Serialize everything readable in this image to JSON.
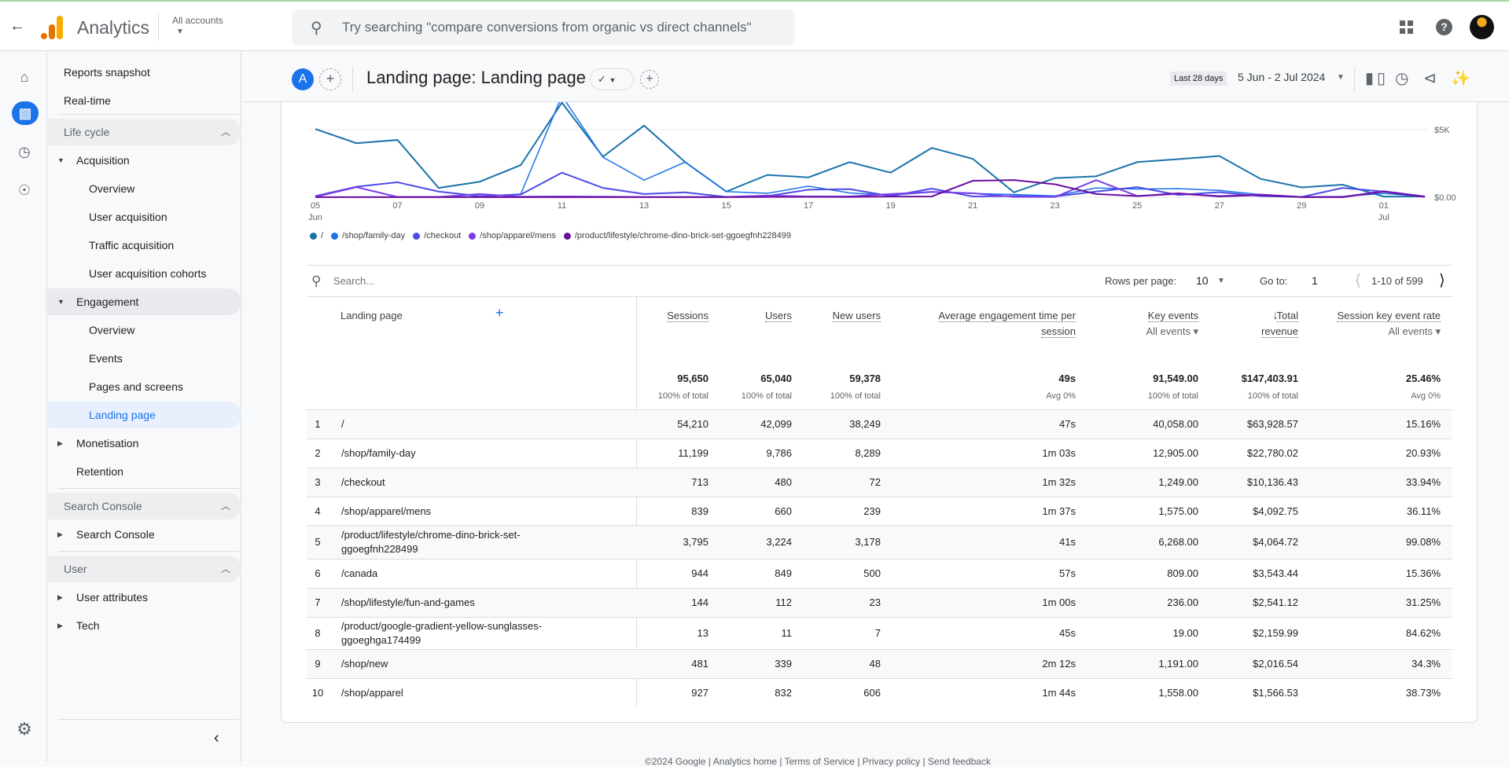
{
  "header": {
    "app_name": "Analytics",
    "accounts_label": "All accounts",
    "search_placeholder": "Try searching \"compare conversions from organic vs direct channels\""
  },
  "rail": {
    "items": [
      "home-icon",
      "reports-icon",
      "explore-icon",
      "advertising-icon"
    ],
    "settings": "gear-icon"
  },
  "nav": {
    "top": [
      {
        "label": "Reports snapshot"
      },
      {
        "label": "Real-time"
      }
    ],
    "sections": [
      {
        "label": "Life cycle",
        "items": [
          {
            "label": "Acquisition",
            "level": 1,
            "caret": "down"
          },
          {
            "label": "Overview",
            "level": 2
          },
          {
            "label": "User acquisition",
            "level": 2
          },
          {
            "label": "Traffic acquisition",
            "level": 2
          },
          {
            "label": "User acquisition cohorts",
            "level": 2
          },
          {
            "label": "Engagement",
            "level": 1,
            "caret": "down",
            "highlight": true
          },
          {
            "label": "Overview",
            "level": 2
          },
          {
            "label": "Events",
            "level": 2
          },
          {
            "label": "Pages and screens",
            "level": 2
          },
          {
            "label": "Landing page",
            "level": 2,
            "active": true
          },
          {
            "label": "Monetisation",
            "level": 1,
            "caret": "right"
          },
          {
            "label": "Retention",
            "level": 1
          }
        ]
      },
      {
        "label": "Search Console",
        "items": [
          {
            "label": "Search Console",
            "level": 1,
            "caret": "right"
          }
        ]
      },
      {
        "label": "User",
        "items": [
          {
            "label": "User attributes",
            "level": 1,
            "caret": "right"
          },
          {
            "label": "Tech",
            "level": 1,
            "caret": "right"
          }
        ]
      }
    ]
  },
  "subheader": {
    "comparison_avatar": "A",
    "title": "Landing page: Landing page",
    "date_preset": "Last 28 days",
    "date_range": "5 Jun - 2 Jul 2024"
  },
  "chart_data": {
    "type": "line",
    "x": [
      "05 Jun",
      "06",
      "07",
      "08",
      "09",
      "10",
      "11",
      "12",
      "13",
      "14",
      "15",
      "16",
      "17",
      "18",
      "19",
      "20",
      "21",
      "22",
      "23",
      "24",
      "25",
      "26",
      "27",
      "28",
      "29",
      "30",
      "01 Jul",
      "02"
    ],
    "x_tick_labels": [
      {
        "day": "05",
        "month": "Jun"
      },
      {
        "day": "07"
      },
      {
        "day": "09"
      },
      {
        "day": "11"
      },
      {
        "day": "13"
      },
      {
        "day": "15"
      },
      {
        "day": "17"
      },
      {
        "day": "19"
      },
      {
        "day": "21"
      },
      {
        "day": "23"
      },
      {
        "day": "25"
      },
      {
        "day": "27"
      },
      {
        "day": "29"
      },
      {
        "day": "01",
        "month": "Jul"
      }
    ],
    "y_tick_labels": [
      "$0.00",
      "$5K"
    ],
    "y_ticks": [
      0,
      5000
    ],
    "ylim": [
      0,
      5600
    ],
    "grid": true,
    "legend_position": "bottom-left",
    "series": [
      {
        "name": "/",
        "color": "#1a73aa",
        "values": [
          5050,
          4000,
          4240,
          690,
          1150,
          2380,
          7000,
          3000,
          5300,
          2600,
          420,
          1650,
          1470,
          2600,
          1820,
          3650,
          2840,
          360,
          1420,
          1550,
          2600,
          2820,
          3050,
          1360,
          730,
          930,
          50,
          60
        ]
      },
      {
        "name": "/shop/family-day",
        "color": "#1a73e8",
        "values": [
          20,
          20,
          30,
          20,
          40,
          240,
          7500,
          2960,
          1270,
          2600,
          420,
          290,
          820,
          320,
          150,
          380,
          280,
          200,
          100,
          690,
          600,
          640,
          510,
          200,
          30,
          60,
          280,
          60
        ]
      },
      {
        "name": "/checkout",
        "color": "#4c4ce6",
        "values": [
          90,
          780,
          1110,
          420,
          90,
          200,
          1820,
          690,
          240,
          360,
          20,
          90,
          560,
          600,
          90,
          640,
          60,
          90,
          60,
          420,
          750,
          170,
          380,
          90,
          20,
          690,
          420,
          60
        ]
      },
      {
        "name": "/shop/apparel/mens",
        "color": "#7b3ee8",
        "values": [
          30,
          750,
          20,
          20,
          240,
          40,
          60,
          40,
          20,
          20,
          20,
          120,
          60,
          60,
          240,
          400,
          300,
          30,
          20,
          1270,
          90,
          250,
          90,
          200,
          20,
          30,
          450,
          60
        ]
      },
      {
        "name": "/product/lifestyle/chrome-dino-brick-set-ggoegfnh228499",
        "color": "#6b0fa0",
        "values": [
          10,
          10,
          10,
          10,
          10,
          10,
          10,
          10,
          10,
          10,
          10,
          20,
          30,
          20,
          50,
          60,
          1220,
          1270,
          960,
          240,
          90,
          290,
          60,
          160,
          10,
          10,
          420,
          20
        ]
      }
    ]
  },
  "table": {
    "search_placeholder": "Search...",
    "rows_per_page_label": "Rows per page:",
    "rows_per_page": "10",
    "goto_label": "Go to:",
    "goto_value": "1",
    "page_range": "1-10 of 599",
    "dimension_header": "Landing page",
    "columns": [
      {
        "label": "Sessions",
        "total": "95,650",
        "total_sub": "100% of total"
      },
      {
        "label": "Users",
        "total": "65,040",
        "total_sub": "100% of total"
      },
      {
        "label": "New users",
        "total": "59,378",
        "total_sub": "100% of total"
      },
      {
        "label": "Average engagement time per session",
        "total": "49s",
        "total_sub": "Avg 0%"
      },
      {
        "label": "Key events",
        "selector": "All events",
        "total": "91,549.00",
        "total_sub": "100% of total"
      },
      {
        "label": "Total revenue",
        "sorted": "descending",
        "total": "$147,403.91",
        "total_sub": "100% of total"
      },
      {
        "label": "Session key event rate",
        "selector": "All events",
        "total": "25.46%",
        "total_sub": "Avg 0%"
      }
    ],
    "rows": [
      [
        "1",
        "/",
        "54,210",
        "42,099",
        "38,249",
        "47s",
        "40,058.00",
        "$63,928.57",
        "15.16%"
      ],
      [
        "2",
        "/shop/family-day",
        "11,199",
        "9,786",
        "8,289",
        "1m 03s",
        "12,905.00",
        "$22,780.02",
        "20.93%"
      ],
      [
        "3",
        "/checkout",
        "713",
        "480",
        "72",
        "1m 32s",
        "1,249.00",
        "$10,136.43",
        "33.94%"
      ],
      [
        "4",
        "/shop/apparel/mens",
        "839",
        "660",
        "239",
        "1m 37s",
        "1,575.00",
        "$4,092.75",
        "36.11%"
      ],
      [
        "5",
        "/product/lifestyle/chrome-dino-brick-set-ggoegfnh228499",
        "3,795",
        "3,224",
        "3,178",
        "41s",
        "6,268.00",
        "$4,064.72",
        "99.08%"
      ],
      [
        "6",
        "/canada",
        "944",
        "849",
        "500",
        "57s",
        "809.00",
        "$3,543.44",
        "15.36%"
      ],
      [
        "7",
        "/shop/lifestyle/fun-and-games",
        "144",
        "112",
        "23",
        "1m 00s",
        "236.00",
        "$2,541.12",
        "31.25%"
      ],
      [
        "8",
        "/product/google-gradient-yellow-sunglasses-ggoeghga174499",
        "13",
        "11",
        "7",
        "45s",
        "19.00",
        "$2,159.99",
        "84.62%"
      ],
      [
        "9",
        "/shop/new",
        "481",
        "339",
        "48",
        "2m 12s",
        "1,191.00",
        "$2,016.54",
        "34.3%"
      ],
      [
        "10",
        "/shop/apparel",
        "927",
        "832",
        "606",
        "1m 44s",
        "1,558.00",
        "$1,566.53",
        "38.73%"
      ]
    ]
  },
  "footer": {
    "text": "©2024 Google | Analytics home | Terms of Service | Privacy policy | Send feedback"
  }
}
